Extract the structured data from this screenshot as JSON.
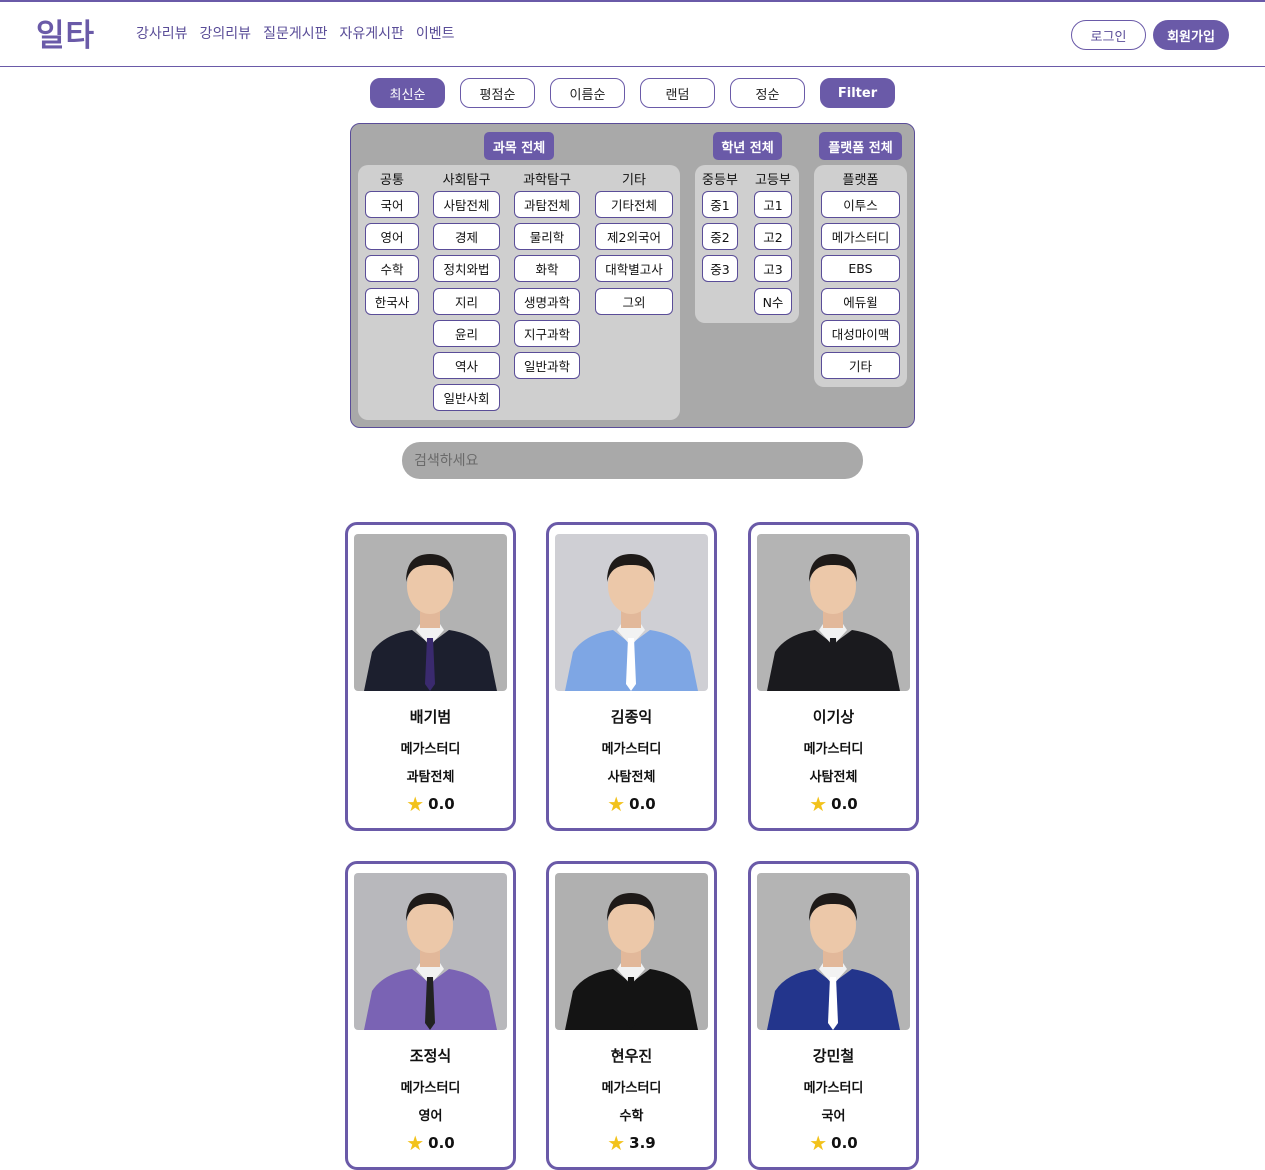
{
  "header": {
    "logo": "일타",
    "nav": [
      "강사리뷰",
      "강의리뷰",
      "질문게시판",
      "자유게시판",
      "이벤트"
    ],
    "login": "로그인",
    "signup": "회원가입"
  },
  "sort": {
    "buttons": [
      "최신순",
      "평점순",
      "이름순",
      "랜덤",
      "정순"
    ],
    "active": "최신순",
    "filter": "Filter"
  },
  "filters": {
    "subject_all": "과목 전체",
    "grade_all": "학년 전체",
    "platform_all": "플랫폼 전체",
    "subject_groups": [
      {
        "title": "공통",
        "items": [
          "국어",
          "영어",
          "수학",
          "한국사"
        ]
      },
      {
        "title": "사회탐구",
        "items": [
          "사탐전체",
          "경제",
          "정치와법",
          "지리",
          "윤리",
          "역사",
          "일반사회"
        ]
      },
      {
        "title": "과학탐구",
        "items": [
          "과탐전체",
          "물리학",
          "화학",
          "생명과학",
          "지구과학",
          "일반과학"
        ]
      },
      {
        "title": "기타",
        "items": [
          "기타전체",
          "제2외국어",
          "대학별고사",
          "그외"
        ]
      }
    ],
    "grade_groups": [
      {
        "title": "중등부",
        "items": [
          "중1",
          "중2",
          "중3"
        ]
      },
      {
        "title": "고등부",
        "items": [
          "고1",
          "고2",
          "고3",
          "N수"
        ]
      }
    ],
    "platform_group": {
      "title": "플랫폼",
      "items": [
        "이투스",
        "메가스터디",
        "EBS",
        "에듀윌",
        "대성마이맥",
        "기타"
      ]
    }
  },
  "search": {
    "placeholder": "검색하세요"
  },
  "colors": {
    "accent": "#6a5aa8",
    "panel": "#a9a9a9",
    "subpanel": "#cfcfcf",
    "star": "#f2c21b"
  },
  "teachers": [
    {
      "name": "배기범",
      "platform": "메가스터디",
      "subject": "과탐전체",
      "rating": "0.0",
      "suit": "#1c1f2e",
      "bg": "#b2b2b2",
      "tie": "#3a2a6e"
    },
    {
      "name": "김종익",
      "platform": "메가스터디",
      "subject": "사탐전체",
      "rating": "0.0",
      "suit": "#7ea6e4",
      "bg": "#cfcfd4",
      "tie": "#ffffff"
    },
    {
      "name": "이기상",
      "platform": "메가스터디",
      "subject": "사탐전체",
      "rating": "0.0",
      "suit": "#1a1a1e",
      "bg": "#b4b4b4",
      "tie": "#1a1a1e"
    },
    {
      "name": "조정식",
      "platform": "메가스터디",
      "subject": "영어",
      "rating": "0.0",
      "suit": "#7a63b4",
      "bg": "#b8b8bc",
      "tie": "#222222"
    },
    {
      "name": "현우진",
      "platform": "메가스터디",
      "subject": "수학",
      "rating": "3.9",
      "suit": "#141414",
      "bg": "#b0b0b0",
      "tie": "#141414"
    },
    {
      "name": "강민철",
      "platform": "메가스터디",
      "subject": "국어",
      "rating": "0.0",
      "suit": "#23358c",
      "bg": "#b4b4b4",
      "tie": "#ffffff"
    }
  ]
}
